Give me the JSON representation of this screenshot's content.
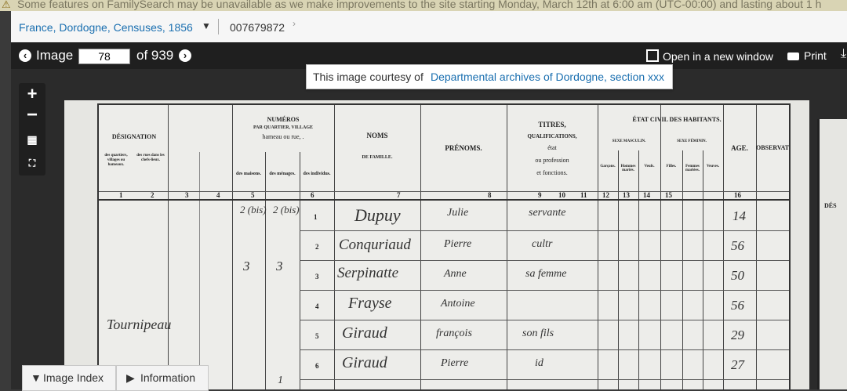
{
  "banner": {
    "text": "Some features on FamilySearch may be unavailable as we make improvements to the site starting Monday, March 12th at 6:00 am (UTC-00:00) and lasting about 1 h"
  },
  "breadcrumb": {
    "collection": "France, Dordogne, Censuses, 1856",
    "film_number": "007679872"
  },
  "toolbar": {
    "image_label": "Image",
    "image_number": "78",
    "of_label": "of 939",
    "open_window": "Open in a new window",
    "print": "Print"
  },
  "courtesy": {
    "prefix": "This image courtesy of",
    "link": "Departmental archives of Dordogne, section xxx"
  },
  "bottom_tabs": {
    "image_index": "Image Index",
    "information": "Information"
  },
  "document": {
    "headers": {
      "designation": "DÉSIGNATION",
      "numeros_title": "NUMÉROS",
      "numeros_sub1": "PAR QUARTIER, VILLAGE",
      "numeros_sub2": "hameau ou rue, .",
      "noms": "NOMS",
      "noms_sub": "DE FAMILLE.",
      "prenoms": "PRÉNOMS.",
      "titres": "TITRES,",
      "titres_sub1": "QUALIFICATIONS,",
      "titres_sub2": "état",
      "titres_sub3": "ou profession",
      "titres_sub4": "et fonctions.",
      "etat_civil": "ÉTAT CIVIL DES HABITANTS.",
      "sexe_masculin": "SEXE MASCULIN.",
      "sexe_feminin": "SEXE FÉMININ.",
      "age": "AGE.",
      "observations": "OBSERVATIONS.",
      "des_quartiers": "des quartiers, villages ou hameaux.",
      "des_rues": "des rues dans les chefs-lieux.",
      "des_maisons": "des maisons.",
      "des_menages": "des ménages.",
      "des_individus": "des individus.",
      "garcons": "Garçons.",
      "hommes_maries": "Hommes mariés.",
      "veufs": "Veufs.",
      "filles": "Filles.",
      "femmes_mariees": "Femmes mariées.",
      "veuves": "Veuves.",
      "right_page_header": "DÉS"
    },
    "column_numbers": [
      "1",
      "2",
      "3",
      "4",
      "5",
      "6",
      "7",
      "8",
      "9",
      "10",
      "11",
      "12",
      "13",
      "14",
      "15",
      "16"
    ],
    "rows": [
      {
        "n": "1",
        "nom": "Dupuy",
        "prenom": "Julie",
        "titre": "servante",
        "age": "14"
      },
      {
        "n": "2",
        "nom": "Conquriaud",
        "prenom": "Pierre",
        "titre": "cultr",
        "age": "56"
      },
      {
        "n": "3",
        "nom": "Serpinatte",
        "prenom": "Anne",
        "titre": "sa femme",
        "age": "50"
      },
      {
        "n": "4",
        "nom": "Frayse",
        "prenom": "Antoine",
        "titre": "",
        "age": "56"
      },
      {
        "n": "5",
        "nom": "Giraud",
        "prenom": "françois",
        "titre": "son fils",
        "age": "29"
      },
      {
        "n": "6",
        "nom": "Giraud",
        "prenom": "Pierre",
        "titre": "id",
        "age": "27"
      }
    ],
    "village": "Tournipeau",
    "house_numbers": {
      "maison_1": "2 (bis)",
      "menage_1": "2 (bis)",
      "maison_2": "3",
      "menage_2": "3",
      "menage_6": "1"
    }
  }
}
